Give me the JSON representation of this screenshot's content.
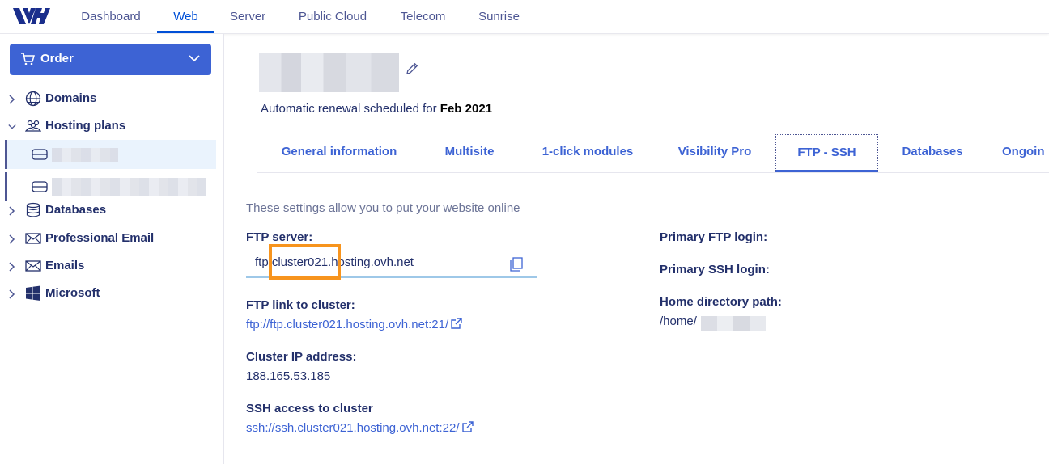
{
  "nav": {
    "items": [
      {
        "label": "Dashboard"
      },
      {
        "label": "Web",
        "active": true
      },
      {
        "label": "Server"
      },
      {
        "label": "Public Cloud"
      },
      {
        "label": "Telecom"
      },
      {
        "label": "Sunrise"
      }
    ]
  },
  "sidebar": {
    "order_label": "Order",
    "items": [
      {
        "label": "Domains",
        "icon": "globe-icon",
        "expanded": false
      },
      {
        "label": "Hosting plans",
        "icon": "people-icon",
        "expanded": true
      },
      {
        "label": "Databases",
        "icon": "database-icon",
        "expanded": false
      },
      {
        "label": "Professional Email",
        "icon": "envelope-icon",
        "expanded": false
      },
      {
        "label": "Emails",
        "icon": "envelope-icon",
        "expanded": false
      },
      {
        "label": "Microsoft",
        "icon": "windows-icon",
        "expanded": false
      }
    ]
  },
  "header": {
    "renewal_prefix": "Automatic renewal scheduled for ",
    "renewal_date": "Feb 2021"
  },
  "tabs": [
    {
      "label": "General information"
    },
    {
      "label": "Multisite"
    },
    {
      "label": "1-click modules"
    },
    {
      "label": "Visibility Pro"
    },
    {
      "label": "FTP - SSH",
      "active": true
    },
    {
      "label": "Databases"
    },
    {
      "label": "Ongoin"
    }
  ],
  "ftp": {
    "description": "These settings allow you to put your website online",
    "server_label": "FTP server:",
    "server_value": "ftp.cluster021.hosting.ovh.net",
    "link_label": "FTP link to cluster:",
    "link_value": "ftp://ftp.cluster021.hosting.ovh.net:21/",
    "ip_label": "Cluster IP address:",
    "ip_value": "188.165.53.185",
    "ssh_label": "SSH access to cluster",
    "ssh_value": "ssh://ssh.cluster021.hosting.ovh.net:22/",
    "primary_ftp_label": "Primary FTP login:",
    "primary_ssh_label": "Primary SSH login:",
    "home_label": "Home directory path:",
    "home_value": "/home/"
  },
  "colors": {
    "accent": "#3d63d4",
    "highlight": "#f7941d",
    "text_dark": "#23306b"
  }
}
